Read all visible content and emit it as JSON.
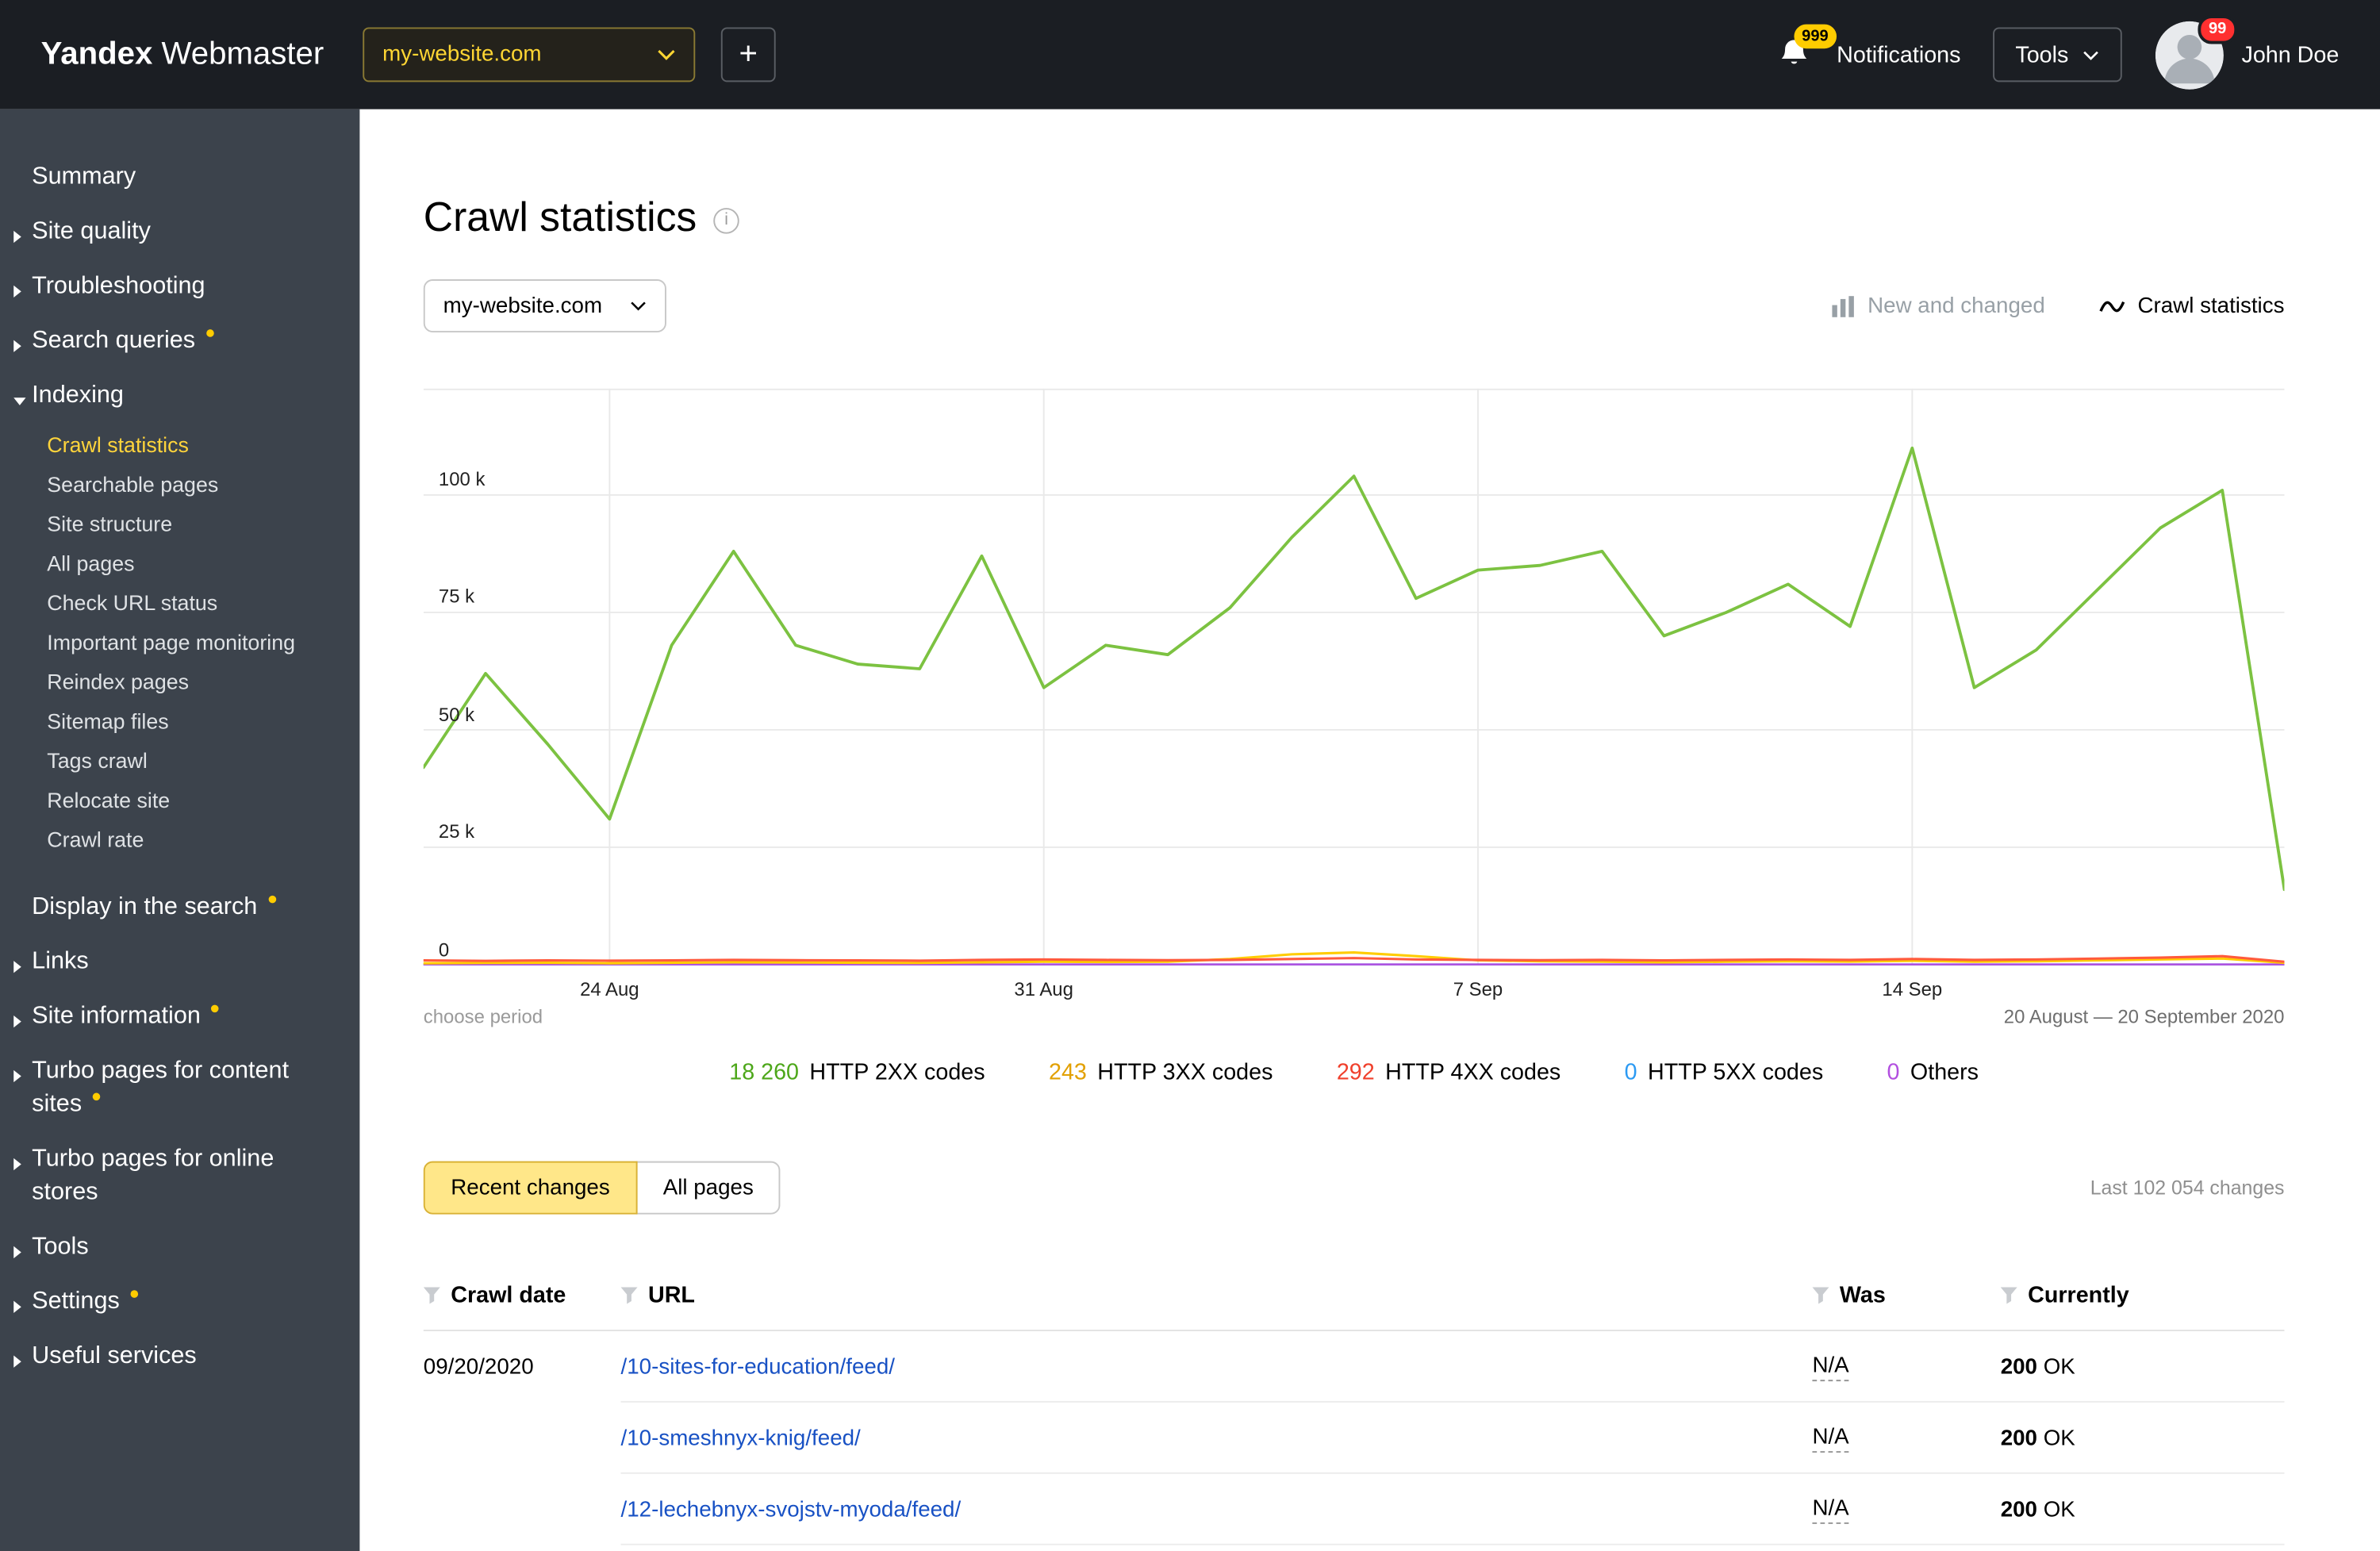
{
  "topbar": {
    "brand_bold": "Yandex",
    "brand_light": "Webmaster",
    "site_selector_value": "my-website.com",
    "add_button_label": "+",
    "notifications_label": "Notifications",
    "notifications_badge": "999",
    "tools_label": "Tools",
    "user_name": "John Doe",
    "user_badge": "99"
  },
  "sidebar": {
    "items": [
      {
        "label": "Summary"
      },
      {
        "label": "Site quality",
        "arrow": "right"
      },
      {
        "label": "Troubleshooting",
        "arrow": "right"
      },
      {
        "label": "Search queries",
        "arrow": "right",
        "dot": true
      },
      {
        "label": "Indexing",
        "arrow": "down",
        "children": [
          {
            "label": "Crawl statistics",
            "active": true
          },
          {
            "label": "Searchable pages"
          },
          {
            "label": "Site structure"
          },
          {
            "label": "All pages"
          },
          {
            "label": "Check URL status"
          },
          {
            "label": "Important page monitoring"
          },
          {
            "label": "Reindex pages"
          },
          {
            "label": "Sitemap files"
          },
          {
            "label": "Tags crawl"
          },
          {
            "label": "Relocate site"
          },
          {
            "label": "Crawl rate"
          }
        ]
      },
      {
        "label": "Display in the search",
        "dot": true,
        "gap": true
      },
      {
        "label": "Links",
        "arrow": "right"
      },
      {
        "label": "Site information",
        "arrow": "right",
        "dot": true
      },
      {
        "label": "Turbo pages for content sites",
        "arrow": "right",
        "dot": true
      },
      {
        "label": "Turbo pages for online stores",
        "arrow": "right"
      },
      {
        "label": "Tools",
        "arrow": "right"
      },
      {
        "label": "Settings",
        "arrow": "right",
        "dot": true
      },
      {
        "label": "Useful services",
        "arrow": "right"
      }
    ]
  },
  "main": {
    "title": "Crawl statistics",
    "site_dropdown_value": "my-website.com",
    "view_toggles": [
      {
        "label": "New and changed",
        "active": false
      },
      {
        "label": "Crawl statistics",
        "active": true
      }
    ],
    "choose_period_label": "choose period",
    "date_range": "20 August — 20 September 2020",
    "legend": [
      {
        "value": "18 260",
        "label": "HTTP 2XX codes",
        "color": "#4da71a"
      },
      {
        "value": "243",
        "label": "HTTP 3XX codes",
        "color": "#e2a000"
      },
      {
        "value": "292",
        "label": "HTTP 4XX codes",
        "color": "#f0402c"
      },
      {
        "value": "0",
        "label": "HTTP 5XX codes",
        "color": "#2b9af3"
      },
      {
        "value": "0",
        "label": "Others",
        "color": "#b24fe0"
      }
    ],
    "tabs": [
      {
        "label": "Recent changes",
        "active": true
      },
      {
        "label": "All pages",
        "active": false
      }
    ],
    "changes_count": "Last 102 054 changes",
    "table": {
      "headers": [
        "Crawl date",
        "URL",
        "Was",
        "Currently"
      ],
      "rows": [
        {
          "date": "09/20/2020",
          "url": "/10-sites-for-education/feed/",
          "was": "N/A",
          "status_code": "200",
          "status_text": "OK"
        },
        {
          "date": "",
          "url": "/10-smeshnyx-knig/feed/",
          "was": "N/A",
          "status_code": "200",
          "status_text": "OK"
        },
        {
          "date": "",
          "url": "/12-lechebnyx-svojstv-myoda/feed/",
          "was": "N/A",
          "status_code": "200",
          "status_text": "OK"
        }
      ]
    }
  },
  "chart_data": {
    "type": "line",
    "title": "Crawl statistics",
    "x": [
      "21 Aug",
      "22 Aug",
      "23 Aug",
      "24 Aug",
      "25 Aug",
      "26 Aug",
      "27 Aug",
      "28 Aug",
      "29 Aug",
      "30 Aug",
      "31 Aug",
      "1 Sep",
      "2 Sep",
      "3 Sep",
      "4 Sep",
      "5 Sep",
      "6 Sep",
      "7 Sep",
      "8 Sep",
      "9 Sep",
      "10 Sep",
      "11 Sep",
      "12 Sep",
      "13 Sep",
      "14 Sep",
      "15 Sep",
      "16 Sep",
      "17 Sep",
      "18 Sep",
      "19 Sep",
      "20 Sep"
    ],
    "xtick_labels": [
      "24 Aug",
      "31 Aug",
      "7 Sep",
      "14 Sep"
    ],
    "xtick_indices": [
      3,
      10,
      17,
      24
    ],
    "ylim": [
      0,
      122500
    ],
    "yticks": [
      0,
      25000,
      50000,
      75000,
      100000
    ],
    "ytick_labels": [
      "0",
      "25 k",
      "50 k",
      "75 k",
      "100 k"
    ],
    "period_label": "20 August — 20 September 2020",
    "grid": true,
    "legend_position": "below",
    "series": [
      {
        "name": "HTTP 2XX codes",
        "color": "#7cc241",
        "values": [
          42000,
          62000,
          47000,
          31000,
          68000,
          88000,
          68000,
          64000,
          63000,
          87000,
          59000,
          68000,
          66000,
          76000,
          91000,
          104000,
          78000,
          84000,
          85000,
          88000,
          70000,
          75000,
          81000,
          72000,
          110000,
          59000,
          67000,
          80000,
          93000,
          101000,
          16000
        ]
      },
      {
        "name": "HTTP 3XX codes",
        "color": "#ffcc00",
        "values": [
          300,
          350,
          400,
          300,
          400,
          500,
          450,
          400,
          350,
          500,
          600,
          550,
          600,
          1200,
          2200,
          2600,
          1800,
          900,
          700,
          600,
          500,
          600,
          700,
          650,
          800,
          600,
          700,
          900,
          1100,
          1300,
          400
        ]
      },
      {
        "name": "HTTP 4XX codes",
        "color": "#ff5a3c",
        "values": [
          900,
          800,
          900,
          850,
          900,
          1000,
          950,
          900,
          850,
          1000,
          1100,
          1000,
          950,
          1000,
          1200,
          1400,
          1100,
          1000,
          950,
          1000,
          900,
          1000,
          1100,
          1000,
          1200,
          1000,
          1100,
          1300,
          1500,
          1800,
          600
        ]
      },
      {
        "name": "HTTP 5XX codes",
        "color": "#2b9af3",
        "values": [
          0,
          0,
          0,
          0,
          0,
          0,
          0,
          0,
          0,
          0,
          0,
          0,
          0,
          0,
          0,
          0,
          0,
          0,
          0,
          0,
          0,
          0,
          0,
          0,
          0,
          0,
          0,
          0,
          0,
          0,
          0
        ]
      },
      {
        "name": "Others",
        "color": "#b24fe0",
        "values": [
          0,
          0,
          0,
          0,
          0,
          0,
          0,
          0,
          0,
          0,
          0,
          0,
          0,
          0,
          0,
          0,
          0,
          0,
          0,
          0,
          0,
          0,
          0,
          0,
          0,
          0,
          0,
          0,
          0,
          0,
          0
        ]
      }
    ]
  }
}
